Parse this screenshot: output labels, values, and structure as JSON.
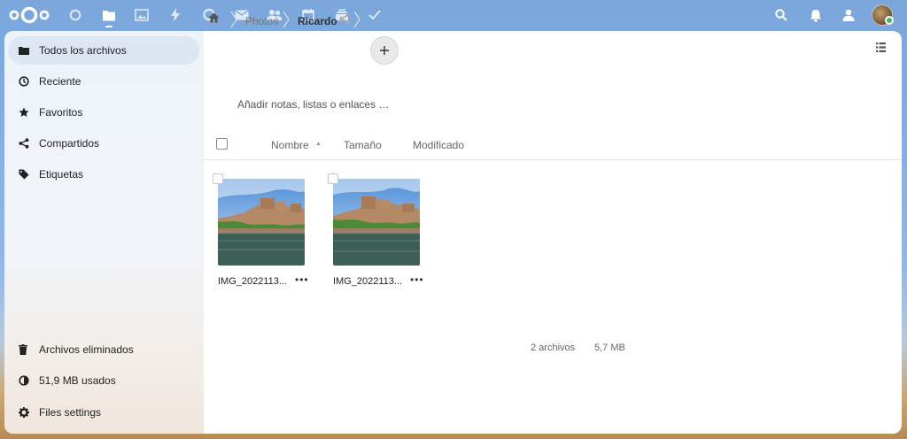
{
  "topbar": {
    "apps": [
      {
        "name": "dashboard-icon",
        "active": false
      },
      {
        "name": "files-icon",
        "active": true
      },
      {
        "name": "photos-icon",
        "active": false
      },
      {
        "name": "activity-icon",
        "active": false
      },
      {
        "name": "talk-icon",
        "active": false
      },
      {
        "name": "mail-icon",
        "active": false
      },
      {
        "name": "contacts-icon",
        "active": false
      },
      {
        "name": "calendar-icon",
        "active": false
      },
      {
        "name": "deck-icon",
        "active": false
      },
      {
        "name": "tasks-icon",
        "active": false
      }
    ],
    "right": [
      "search-icon",
      "notifications-icon",
      "contacts-menu-icon",
      "avatar"
    ]
  },
  "sidebar": {
    "items": [
      {
        "label": "Todos los archivos",
        "icon": "folder-icon",
        "active": true
      },
      {
        "label": "Reciente",
        "icon": "clock-icon"
      },
      {
        "label": "Favoritos",
        "icon": "star-icon"
      },
      {
        "label": "Compartidos",
        "icon": "share-icon"
      },
      {
        "label": "Etiquetas",
        "icon": "tag-icon"
      }
    ],
    "bottom": [
      {
        "label": "Archivos eliminados",
        "icon": "trash-icon"
      },
      {
        "label": "51,9 MB usados",
        "icon": "quota-icon"
      },
      {
        "label": "Files settings",
        "icon": "gear-icon"
      }
    ]
  },
  "breadcrumb": {
    "items": [
      "Photos",
      "Ricardo"
    ]
  },
  "notes_placeholder": "Añadir notas, listas o enlaces …",
  "columns": {
    "name": "Nombre",
    "size": "Tamaño",
    "modified": "Modificado"
  },
  "files": [
    {
      "name": "IMG_2022113...",
      "actions": "•••"
    },
    {
      "name": "IMG_2022113...",
      "actions": "•••"
    }
  ],
  "summary": {
    "count": "2 archivos",
    "size": "5,7 MB"
  },
  "colors": {
    "accent": "#0082c9",
    "active_nav_bg": "#dde6f2",
    "status_online": "#46ba61"
  }
}
